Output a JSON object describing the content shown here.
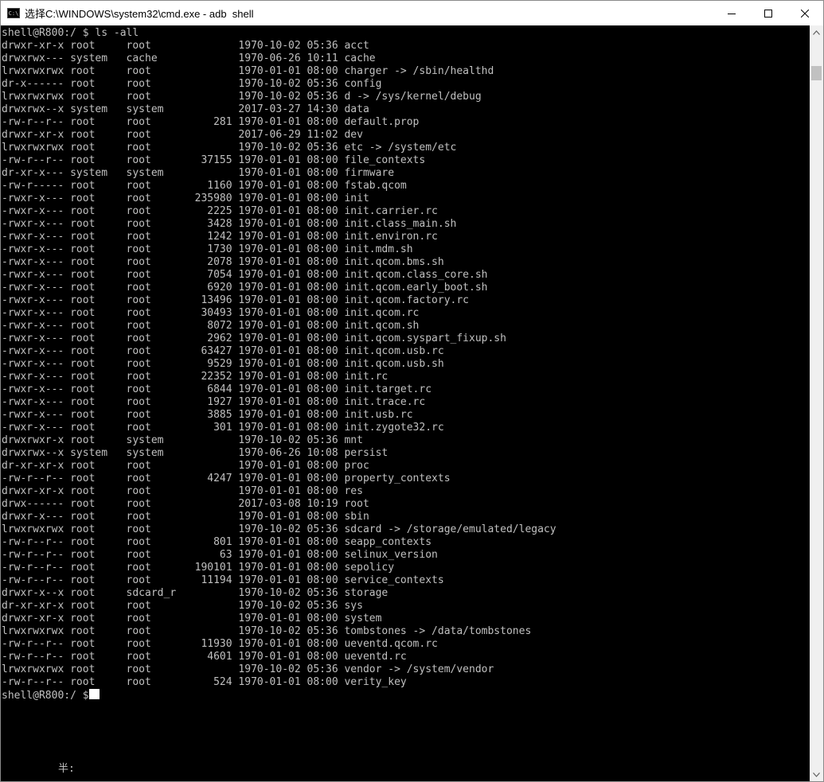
{
  "window": {
    "title": "选择C:\\WINDOWS\\system32\\cmd.exe - adb  shell"
  },
  "icons": {
    "app": "cmd-icon",
    "minimize": "minimize-icon",
    "maximize": "maximize-icon",
    "close": "close-icon"
  },
  "terminal": {
    "prompt_line": "shell@R800:/ $ ls -all",
    "rows": [
      [
        "drwxr-xr-x",
        "root",
        "root",
        "",
        "1970-10-02",
        "05:36",
        "acct"
      ],
      [
        "drwxrwx---",
        "system",
        "cache",
        "",
        "1970-06-26",
        "10:11",
        "cache"
      ],
      [
        "lrwxrwxrwx",
        "root",
        "root",
        "",
        "1970-01-01",
        "08:00",
        "charger -> /sbin/healthd"
      ],
      [
        "dr-x------",
        "root",
        "root",
        "",
        "1970-10-02",
        "05:36",
        "config"
      ],
      [
        "lrwxrwxrwx",
        "root",
        "root",
        "",
        "1970-10-02",
        "05:36",
        "d -> /sys/kernel/debug"
      ],
      [
        "drwxrwx--x",
        "system",
        "system",
        "",
        "2017-03-27",
        "14:30",
        "data"
      ],
      [
        "-rw-r--r--",
        "root",
        "root",
        "281",
        "1970-01-01",
        "08:00",
        "default.prop"
      ],
      [
        "drwxr-xr-x",
        "root",
        "root",
        "",
        "2017-06-29",
        "11:02",
        "dev"
      ],
      [
        "lrwxrwxrwx",
        "root",
        "root",
        "",
        "1970-10-02",
        "05:36",
        "etc -> /system/etc"
      ],
      [
        "-rw-r--r--",
        "root",
        "root",
        "37155",
        "1970-01-01",
        "08:00",
        "file_contexts"
      ],
      [
        "dr-xr-x---",
        "system",
        "system",
        "",
        "1970-01-01",
        "08:00",
        "firmware"
      ],
      [
        "-rw-r-----",
        "root",
        "root",
        "1160",
        "1970-01-01",
        "08:00",
        "fstab.qcom"
      ],
      [
        "-rwxr-x---",
        "root",
        "root",
        "235980",
        "1970-01-01",
        "08:00",
        "init"
      ],
      [
        "-rwxr-x---",
        "root",
        "root",
        "2225",
        "1970-01-01",
        "08:00",
        "init.carrier.rc"
      ],
      [
        "-rwxr-x---",
        "root",
        "root",
        "3428",
        "1970-01-01",
        "08:00",
        "init.class_main.sh"
      ],
      [
        "-rwxr-x---",
        "root",
        "root",
        "1242",
        "1970-01-01",
        "08:00",
        "init.environ.rc"
      ],
      [
        "-rwxr-x---",
        "root",
        "root",
        "1730",
        "1970-01-01",
        "08:00",
        "init.mdm.sh"
      ],
      [
        "-rwxr-x---",
        "root",
        "root",
        "2078",
        "1970-01-01",
        "08:00",
        "init.qcom.bms.sh"
      ],
      [
        "-rwxr-x---",
        "root",
        "root",
        "7054",
        "1970-01-01",
        "08:00",
        "init.qcom.class_core.sh"
      ],
      [
        "-rwxr-x---",
        "root",
        "root",
        "6920",
        "1970-01-01",
        "08:00",
        "init.qcom.early_boot.sh"
      ],
      [
        "-rwxr-x---",
        "root",
        "root",
        "13496",
        "1970-01-01",
        "08:00",
        "init.qcom.factory.rc"
      ],
      [
        "-rwxr-x---",
        "root",
        "root",
        "30493",
        "1970-01-01",
        "08:00",
        "init.qcom.rc"
      ],
      [
        "-rwxr-x---",
        "root",
        "root",
        "8072",
        "1970-01-01",
        "08:00",
        "init.qcom.sh"
      ],
      [
        "-rwxr-x---",
        "root",
        "root",
        "2962",
        "1970-01-01",
        "08:00",
        "init.qcom.syspart_fixup.sh"
      ],
      [
        "-rwxr-x---",
        "root",
        "root",
        "63427",
        "1970-01-01",
        "08:00",
        "init.qcom.usb.rc"
      ],
      [
        "-rwxr-x---",
        "root",
        "root",
        "9529",
        "1970-01-01",
        "08:00",
        "init.qcom.usb.sh"
      ],
      [
        "-rwxr-x---",
        "root",
        "root",
        "22352",
        "1970-01-01",
        "08:00",
        "init.rc"
      ],
      [
        "-rwxr-x---",
        "root",
        "root",
        "6844",
        "1970-01-01",
        "08:00",
        "init.target.rc"
      ],
      [
        "-rwxr-x---",
        "root",
        "root",
        "1927",
        "1970-01-01",
        "08:00",
        "init.trace.rc"
      ],
      [
        "-rwxr-x---",
        "root",
        "root",
        "3885",
        "1970-01-01",
        "08:00",
        "init.usb.rc"
      ],
      [
        "-rwxr-x---",
        "root",
        "root",
        "301",
        "1970-01-01",
        "08:00",
        "init.zygote32.rc"
      ],
      [
        "drwxrwxr-x",
        "root",
        "system",
        "",
        "1970-10-02",
        "05:36",
        "mnt"
      ],
      [
        "drwxrwx--x",
        "system",
        "system",
        "",
        "1970-06-26",
        "10:08",
        "persist"
      ],
      [
        "dr-xr-xr-x",
        "root",
        "root",
        "",
        "1970-01-01",
        "08:00",
        "proc"
      ],
      [
        "-rw-r--r--",
        "root",
        "root",
        "4247",
        "1970-01-01",
        "08:00",
        "property_contexts"
      ],
      [
        "drwxr-xr-x",
        "root",
        "root",
        "",
        "1970-01-01",
        "08:00",
        "res"
      ],
      [
        "drwx------",
        "root",
        "root",
        "",
        "2017-03-08",
        "10:19",
        "root"
      ],
      [
        "drwxr-x---",
        "root",
        "root",
        "",
        "1970-01-01",
        "08:00",
        "sbin"
      ],
      [
        "lrwxrwxrwx",
        "root",
        "root",
        "",
        "1970-10-02",
        "05:36",
        "sdcard -> /storage/emulated/legacy"
      ],
      [
        "-rw-r--r--",
        "root",
        "root",
        "801",
        "1970-01-01",
        "08:00",
        "seapp_contexts"
      ],
      [
        "-rw-r--r--",
        "root",
        "root",
        "63",
        "1970-01-01",
        "08:00",
        "selinux_version"
      ],
      [
        "-rw-r--r--",
        "root",
        "root",
        "190101",
        "1970-01-01",
        "08:00",
        "sepolicy"
      ],
      [
        "-rw-r--r--",
        "root",
        "root",
        "11194",
        "1970-01-01",
        "08:00",
        "service_contexts"
      ],
      [
        "drwxr-x--x",
        "root",
        "sdcard_r",
        "",
        "1970-10-02",
        "05:36",
        "storage"
      ],
      [
        "dr-xr-xr-x",
        "root",
        "root",
        "",
        "1970-10-02",
        "05:36",
        "sys"
      ],
      [
        "drwxr-xr-x",
        "root",
        "root",
        "",
        "1970-01-01",
        "08:00",
        "system"
      ],
      [
        "lrwxrwxrwx",
        "root",
        "root",
        "",
        "1970-10-02",
        "05:36",
        "tombstones -> /data/tombstones"
      ],
      [
        "-rw-r--r--",
        "root",
        "root",
        "11930",
        "1970-01-01",
        "08:00",
        "ueventd.qcom.rc"
      ],
      [
        "-rw-r--r--",
        "root",
        "root",
        "4601",
        "1970-01-01",
        "08:00",
        "ueventd.rc"
      ],
      [
        "lrwxrwxrwx",
        "root",
        "root",
        "",
        "1970-10-02",
        "05:36",
        "vendor -> /system/vendor"
      ],
      [
        "-rw-r--r--",
        "root",
        "root",
        "524",
        "1970-01-01",
        "08:00",
        "verity_key"
      ]
    ],
    "final_prompt": "shell@R800:/ $"
  },
  "ime": {
    "status": "半:"
  }
}
